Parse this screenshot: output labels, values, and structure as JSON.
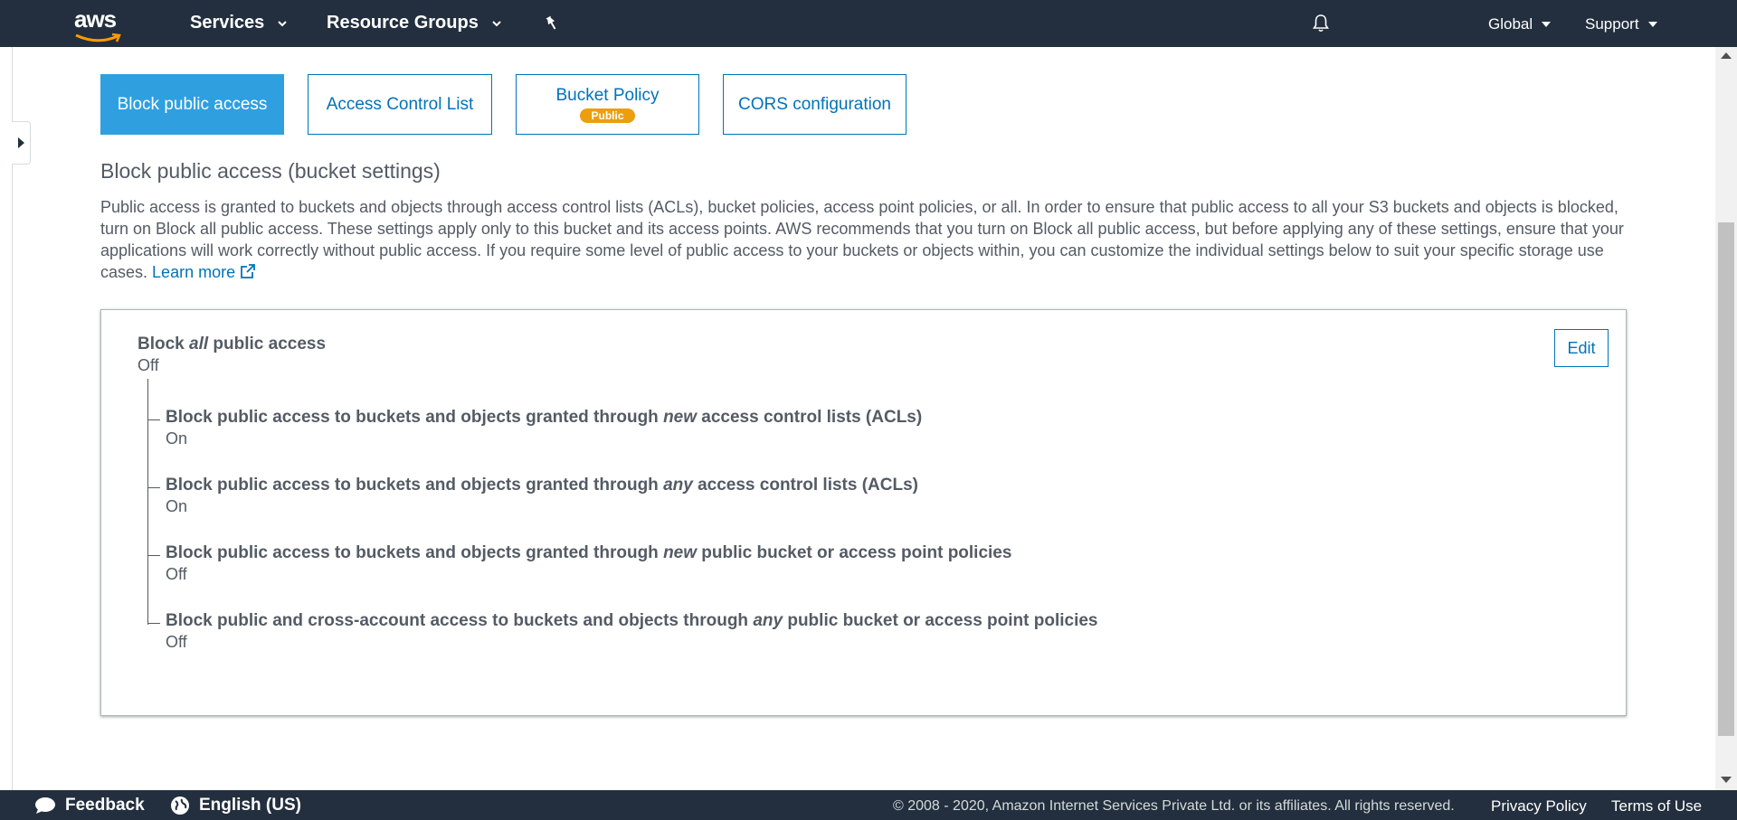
{
  "topnav": {
    "logo_text": "aws",
    "services": "Services",
    "resource_groups": "Resource Groups",
    "region": "Global",
    "support": "Support"
  },
  "tabs": [
    {
      "label": "Block public access",
      "active": true
    },
    {
      "label": "Access Control List",
      "active": false
    },
    {
      "label": "Bucket Policy",
      "badge": "Public",
      "active": false
    },
    {
      "label": "CORS configuration",
      "active": false
    }
  ],
  "section": {
    "title": "Block public access (bucket settings)",
    "description": "Public access is granted to buckets and objects through access control lists (ACLs), bucket policies, access point policies, or all. In order to ensure that public access to all your S3 buckets and objects is blocked, turn on Block all public access. These settings apply only to this bucket and its access points. AWS recommends that you turn on Block all public access, but before applying any of these settings, ensure that your applications will work correctly without public access. If you require some level of public access to your buckets or objects within, you can customize the individual settings below to suit your specific storage use cases.",
    "learn_more": "Learn more"
  },
  "panel": {
    "edit_label": "Edit",
    "master": {
      "pre": "Block ",
      "em": "all",
      "post": " public access",
      "value": "Off"
    },
    "settings": [
      {
        "pre": "Block public access to buckets and objects granted through ",
        "em": "new",
        "post": " access control lists (ACLs)",
        "value": "On"
      },
      {
        "pre": "Block public access to buckets and objects granted through ",
        "em": "any",
        "post": " access control lists (ACLs)",
        "value": "On"
      },
      {
        "pre": "Block public access to buckets and objects granted through ",
        "em": "new",
        "post": " public bucket or access point policies",
        "value": "Off"
      },
      {
        "pre": "Block public and cross-account access to buckets and objects through ",
        "em": "any",
        "post": " public bucket or access point policies",
        "value": "Off"
      }
    ]
  },
  "footer": {
    "feedback": "Feedback",
    "language": "English (US)",
    "copyright": "© 2008 - 2020, Amazon Internet Services Private Ltd. or its affiliates. All rights reserved.",
    "privacy": "Privacy Policy",
    "terms": "Terms of Use"
  },
  "colors": {
    "nav_bg": "#232f3e",
    "link": "#0073bb",
    "active_tab": "#2f9fe0",
    "badge": "#ec9e0f"
  }
}
